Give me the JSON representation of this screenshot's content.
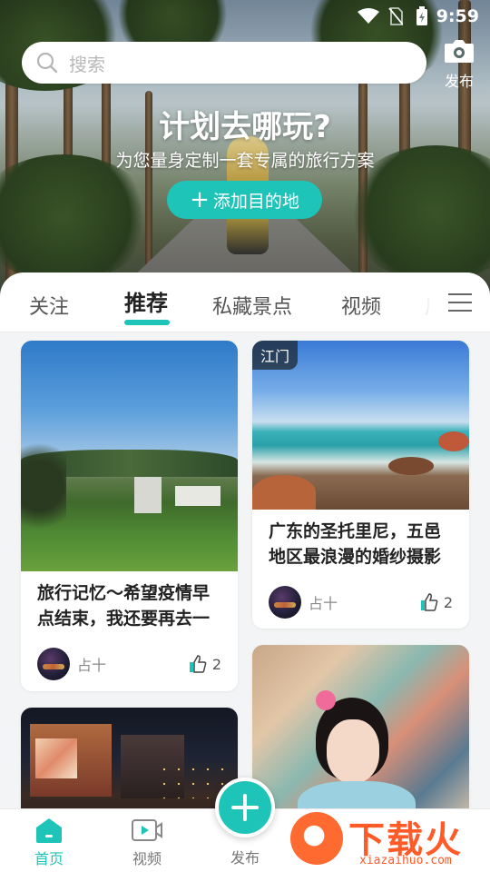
{
  "status_bar": {
    "time": "9:59"
  },
  "search": {
    "placeholder": "搜索"
  },
  "header": {
    "publish_label": "发布"
  },
  "hero": {
    "title": "计划去哪玩?",
    "subtitle": "为您量身定制一套专属的旅行方案",
    "add_button_label": "添加目的地"
  },
  "tabs": [
    {
      "label": "关注",
      "active": false
    },
    {
      "label": "推荐",
      "active": true
    },
    {
      "label": "私藏景点",
      "active": false
    },
    {
      "label": "视频",
      "active": false
    },
    {
      "label": "周",
      "active": false
    }
  ],
  "feed": {
    "cards": [
      {
        "title": "旅行记忆～希望疫情早点结束，我还要再去一",
        "author": "占十",
        "likes": "2",
        "city_tag": ""
      },
      {
        "title": "广东的圣托里尼，五邑地区最浪漫的婚纱摄影",
        "author": "占十",
        "likes": "2",
        "city_tag": "江门"
      },
      {
        "title": "",
        "author": "",
        "likes": "",
        "city_tag": ""
      },
      {
        "title": "",
        "author": "",
        "likes": "",
        "city_tag": ""
      }
    ]
  },
  "bottom_nav": {
    "items": [
      {
        "label": "首页",
        "icon": "home-icon",
        "active": true
      },
      {
        "label": "视频",
        "icon": "video-icon",
        "active": false
      },
      {
        "label": "发布",
        "icon": "plus-icon",
        "active": false
      }
    ]
  },
  "watermark": {
    "text": "下载火",
    "url": "xiazaihuo.com"
  },
  "colors": {
    "accent": "#1fc4b8",
    "watermark": "#ff5a28"
  }
}
